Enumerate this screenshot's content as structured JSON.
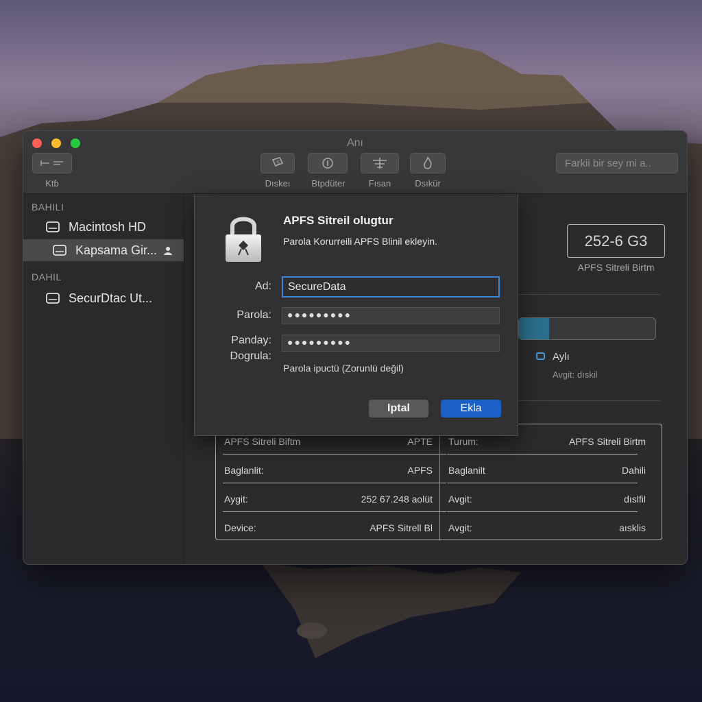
{
  "window": {
    "title": "Anı"
  },
  "toolbar": {
    "left_button_label": "Ktɓ",
    "buttons": [
      {
        "label": "Dıskeı"
      },
      {
        "label": "Btpdüter"
      },
      {
        "label": "Fısan"
      },
      {
        "label": "Dѕıkür"
      }
    ],
    "search_placeholder": "Farkii bir sey mi a.."
  },
  "sidebar": {
    "sections": [
      {
        "header": "BAHILI"
      },
      {
        "header": "DAHIL"
      }
    ],
    "items": [
      {
        "label": "Macintosh HD"
      },
      {
        "label": "Kapsama Gir..."
      },
      {
        "label": "SecurDtac Ut..."
      }
    ]
  },
  "sheet": {
    "title": "APFS Sitreil olugtur",
    "subtitle": "Parola Korurreili APFS Blinil ekleyin.",
    "fields": {
      "name_label": "Ad:",
      "name_value": "SecureData",
      "password_label": "Parola:",
      "password_value": "●●●●●●●●●",
      "verify_label_1": "Panday:",
      "verify_label_2": "Dogrula:",
      "verify_value": "●●●●●●●●●"
    },
    "hint": "Parola ipuctü (Zorunlü değil)",
    "cancel_label": "Iptal",
    "ok_label": "Ekla"
  },
  "capacity": {
    "value": "252-6 G3",
    "label": "APFS Sitreli Birtm"
  },
  "usage": {
    "fill_fraction": 0.22,
    "legend_label": "Aylı",
    "legend_sub": "Avgit: dıskil"
  },
  "info": {
    "left_rows": [
      {
        "key": "APFS Sitreli Biftm",
        "value": "APTE"
      },
      {
        "key": "Baglanlit:",
        "value": "APFS"
      },
      {
        "key": "Aygit:",
        "value": "252 67.248  aolüt"
      },
      {
        "key": "Device:",
        "value": "APFS Sitrell Bl"
      }
    ],
    "right_rows": [
      {
        "key": "Turum:",
        "value": "APFS Sitreli Birtm"
      },
      {
        "key": "Baglanilt",
        "value": "Dahili"
      },
      {
        "key": "Avgit:",
        "value": "dıslfil"
      },
      {
        "key": "Avgit:",
        "value": "aısklis"
      }
    ]
  },
  "colors": {
    "accent": "#1b5fc9",
    "focus": "#3a86d4",
    "usage_fill": "#2d6f8e"
  }
}
